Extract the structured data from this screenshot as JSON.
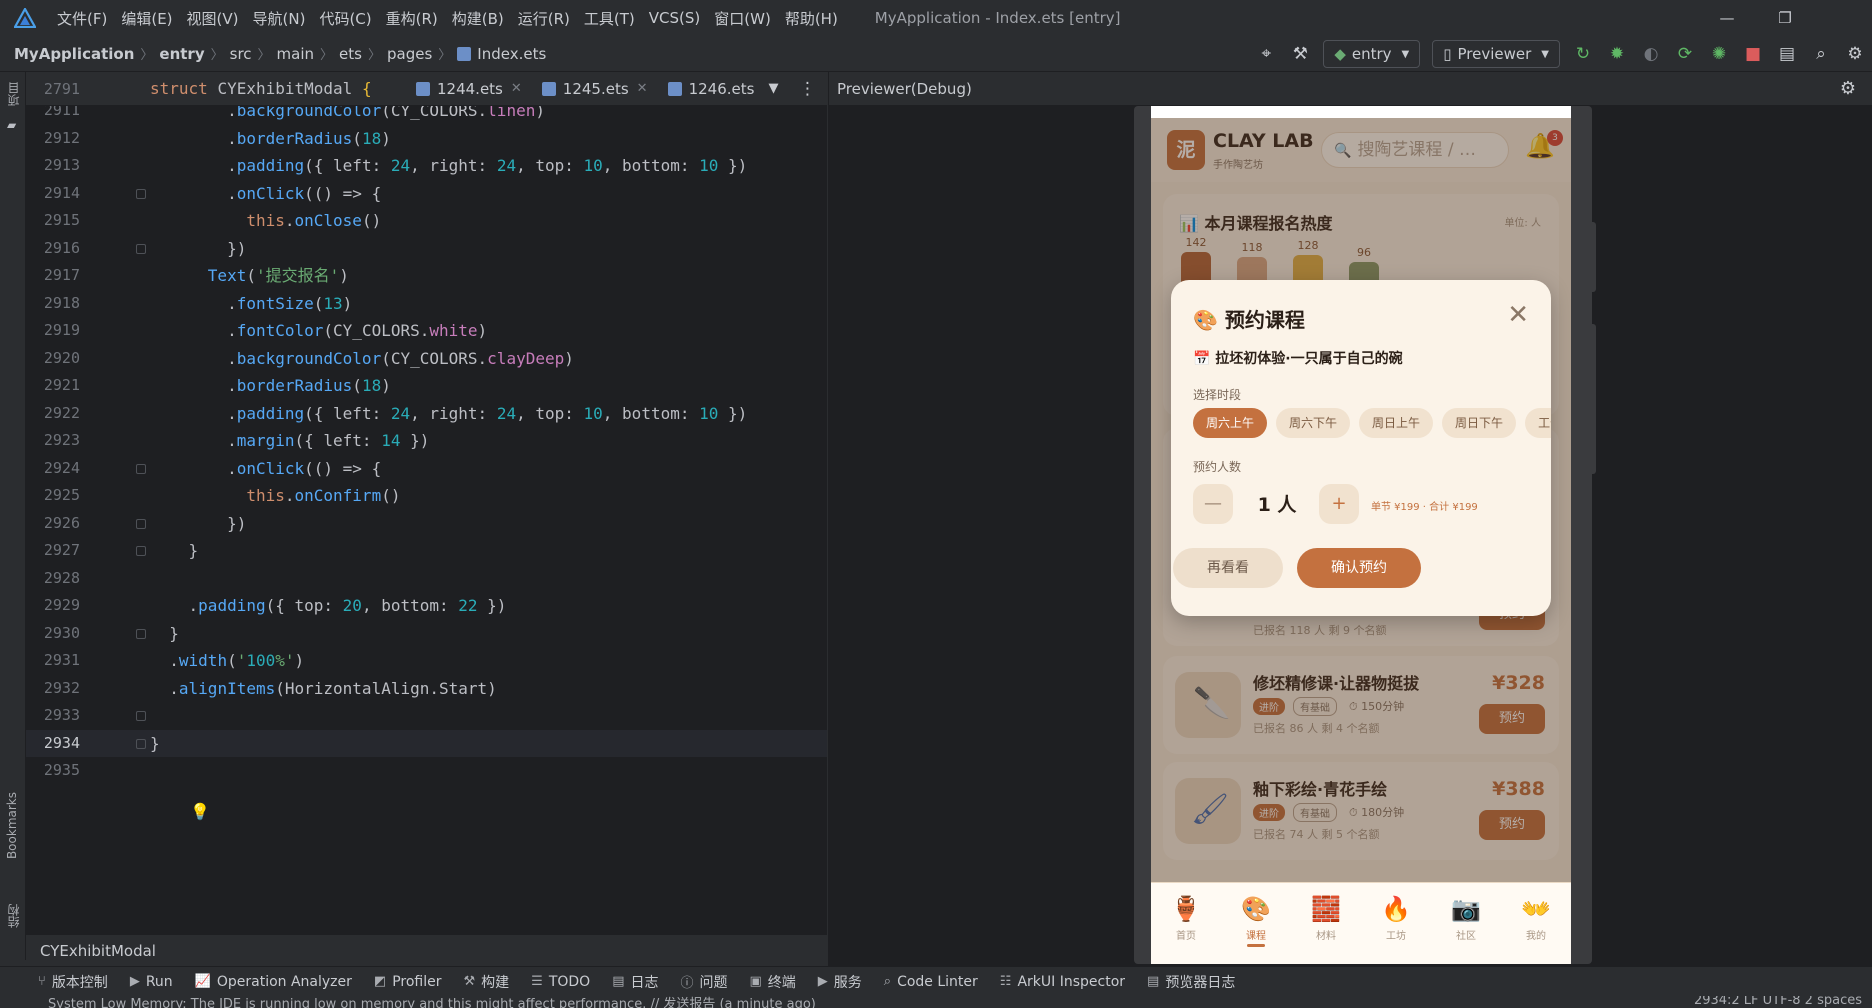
{
  "menubar": {
    "items": [
      "文件(F)",
      "编辑(E)",
      "视图(V)",
      "导航(N)",
      "代码(C)",
      "重构(R)",
      "构建(B)",
      "运行(R)",
      "工具(T)",
      "VCS(S)",
      "窗口(W)",
      "帮助(H)"
    ],
    "window_title": "MyApplication - Index.ets [entry]",
    "minimize": "—",
    "restore": "❐"
  },
  "navbar": {
    "crumbs": [
      "MyApplication",
      "entry",
      "src",
      "main",
      "ets",
      "pages",
      "Index.ets"
    ],
    "run_config": "entry",
    "previewer": "Previewer"
  },
  "leftstrip": {
    "project": "项目",
    "bookmarks": "Bookmarks",
    "structure": "结构"
  },
  "editor": {
    "sticky_line_no": "2791",
    "tabs": [
      "1244.ets",
      "1245.ets",
      "1246.ets"
    ],
    "lines": [
      {
        "no": "2911",
        "code": "        .backgroundColor(CY_COLORS.linen)"
      },
      {
        "no": "2912",
        "code": "        .borderRadius(18)"
      },
      {
        "no": "2913",
        "code": "        .padding({ left: 24, right: 24, top: 10, bottom: 10 })"
      },
      {
        "no": "2914",
        "code": "        .onClick(() => {"
      },
      {
        "no": "2915",
        "code": "          this.onClose()"
      },
      {
        "no": "2916",
        "code": "        })"
      },
      {
        "no": "2917",
        "code": "      Text('提交报名')"
      },
      {
        "no": "2918",
        "code": "        .fontSize(13)"
      },
      {
        "no": "2919",
        "code": "        .fontColor(CY_COLORS.white)"
      },
      {
        "no": "2920",
        "code": "        .backgroundColor(CY_COLORS.clayDeep)"
      },
      {
        "no": "2921",
        "code": "        .borderRadius(18)"
      },
      {
        "no": "2922",
        "code": "        .padding({ left: 24, right: 24, top: 10, bottom: 10 })"
      },
      {
        "no": "2923",
        "code": "        .margin({ left: 14 })"
      },
      {
        "no": "2924",
        "code": "        .onClick(() => {"
      },
      {
        "no": "2925",
        "code": "          this.onConfirm()"
      },
      {
        "no": "2926",
        "code": "        })"
      },
      {
        "no": "2927",
        "code": "    }"
      },
      {
        "no": "2928",
        "code": ""
      },
      {
        "no": "2929",
        "code": "    .padding({ top: 20, bottom: 22 })"
      },
      {
        "no": "2930",
        "code": "  }"
      },
      {
        "no": "2931",
        "code": "  .width('100%')"
      },
      {
        "no": "2932",
        "code": "  .alignItems(HorizontalAlign.Start)"
      },
      {
        "no": "2933",
        "code": ""
      },
      {
        "no": "2934",
        "code": "}"
      },
      {
        "no": "2935",
        "code": ""
      }
    ],
    "struct_crumb": "CYExhibitModal"
  },
  "previewer": {
    "title": "Previewer(Debug)",
    "app": {
      "logo_char": "泥",
      "brand": "CLAY LAB",
      "brand_sub": "手作陶艺坊",
      "search_placeholder": "搜陶艺课程 / …",
      "bell_badge": "3",
      "stats": {
        "title": "📊 本月课程报名热度",
        "unit": "单位: 人",
        "values": [
          142,
          118,
          128,
          96
        ]
      },
      "courses": [
        {
          "title": "修坯精修课·让器物挺拔",
          "price": "¥328",
          "level": "进阶",
          "prereq": "有基础",
          "duration": "⏱ 150分钟",
          "meta": "已报名 86 人   剩 4 个名额",
          "book": "预约"
        },
        {
          "title": "釉下彩绘·青花手绘",
          "price": "¥388",
          "level": "进阶",
          "prereq": "有基础",
          "duration": "⏱ 180分钟",
          "meta": "已报名 74 人   剩 5 个名额",
          "book": "预约"
        }
      ],
      "partial_meta": "已报名 118 人   剩 9 个名额",
      "partial_book": "预约",
      "tabs": [
        {
          "icon": "🏺",
          "label": "首页"
        },
        {
          "icon": "🎨",
          "label": "课程"
        },
        {
          "icon": "🧱",
          "label": "材料"
        },
        {
          "icon": "🔥",
          "label": "工坊"
        },
        {
          "icon": "📷",
          "label": "社区"
        },
        {
          "icon": "👐",
          "label": "我的"
        }
      ],
      "modal": {
        "title": "🎨 预约课程",
        "close": "✕",
        "course": "📅 拉坯初体验·一只属于自己的碗",
        "slot_label": "选择时段",
        "slots": [
          "周六上午",
          "周六下午",
          "周日上午",
          "周日下午",
          "工作日晚"
        ],
        "count_label": "预约人数",
        "minus": "—",
        "count": "1 人",
        "plus": "+",
        "price_note": "单节 ¥199 · 合计 ¥199",
        "cancel": "再看看",
        "confirm": "确认预约"
      }
    }
  },
  "bottom_tools": [
    "版本控制",
    "Run",
    "Operation Analyzer",
    "Profiler",
    "构建",
    "TODO",
    "日志",
    "问题",
    "终端",
    "服务",
    "Code Linter",
    "ArkUI Inspector",
    "预览器日志"
  ],
  "status": {
    "message": "System Low Memory: The IDE is running low on memory and this might affect performance. // 发送报告 (a minute ago)",
    "position": "2934:2   LF   UTF-8   2 spaces"
  },
  "colors": {
    "accent": "#c4713f",
    "editor_bg": "#1e1f22",
    "chrome_bg": "#2b2d30"
  }
}
